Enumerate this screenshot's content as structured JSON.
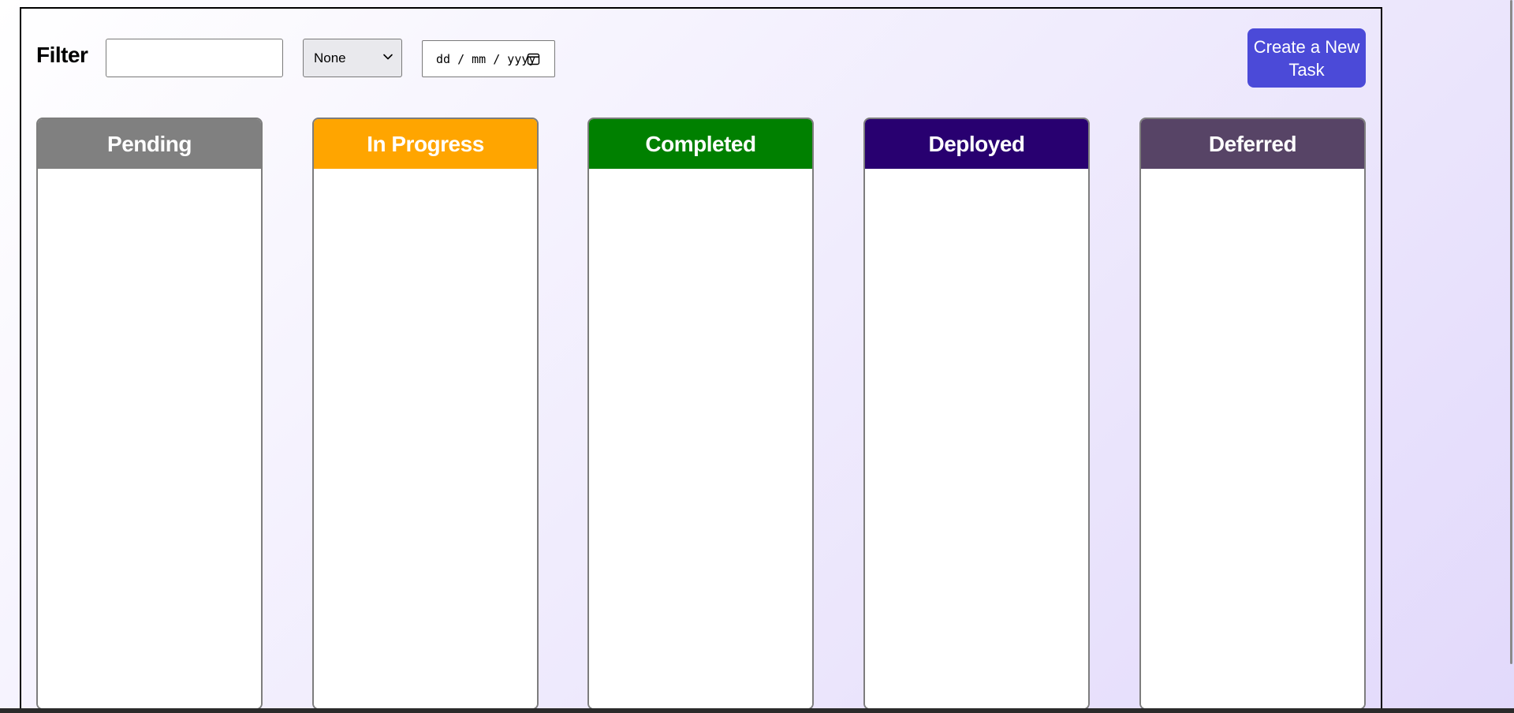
{
  "filter": {
    "label": "Filter",
    "search_value": "",
    "search_placeholder": ""
  },
  "priority_select": {
    "selected": "None"
  },
  "date_filter": {
    "placeholder_text": "dd / mm / yyyy"
  },
  "create_button": {
    "label": "Create a New Task"
  },
  "columns": [
    {
      "title": "Pending",
      "color": "#808080"
    },
    {
      "title": "In Progress",
      "color": "#ffa500"
    },
    {
      "title": "Completed",
      "color": "#008000"
    },
    {
      "title": "Deployed",
      "color": "#280070"
    },
    {
      "title": "Deferred",
      "color": "#574466"
    }
  ],
  "icons": {
    "select_arrow": "chevron-down-icon",
    "calendar": "calendar-icon"
  }
}
